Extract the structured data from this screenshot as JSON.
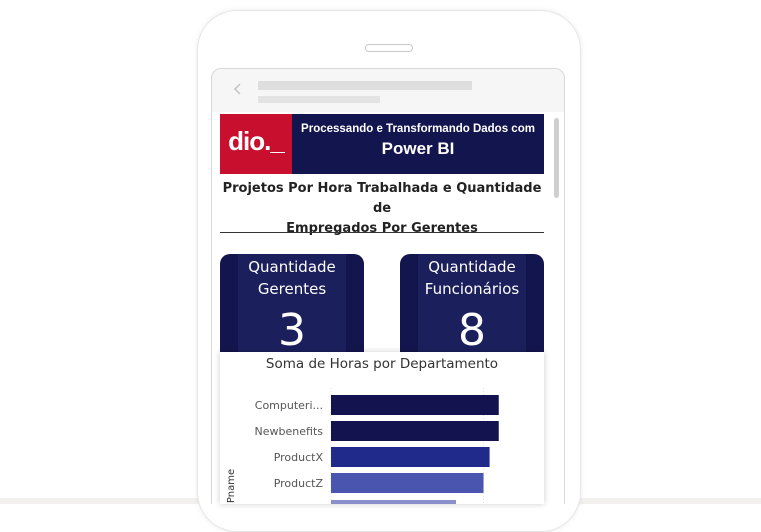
{
  "banner": {
    "logo_text": "dio._",
    "subtitle": "Processando e Transformando Dados com",
    "title": "Power BI",
    "colors": {
      "navy": "#13154e",
      "logo_red": "#c8102e"
    }
  },
  "report": {
    "title_line1": "Projetos Por Hora Trabalhada e Quantidade de",
    "title_line2": "Empregados Por Gerentes"
  },
  "cards": [
    {
      "label_line1": "Quantidade",
      "label_line2": "Gerentes",
      "value": "3"
    },
    {
      "label_line1": "Quantidade",
      "label_line2": "Funcionários",
      "value": "8"
    }
  ],
  "chart_data": {
    "type": "bar",
    "orientation": "horizontal",
    "title": "Soma de Horas por Departamento",
    "ylabel": "Pname",
    "categories": [
      "Computeri...",
      "Newbenefits",
      "ProductX",
      "ProductZ"
    ],
    "values": [
      55,
      55,
      52,
      50
    ],
    "xlim": [
      0,
      60
    ],
    "colors": [
      "#12134f",
      "#12134f",
      "#1f2a8a",
      "#4a55b0"
    ]
  }
}
